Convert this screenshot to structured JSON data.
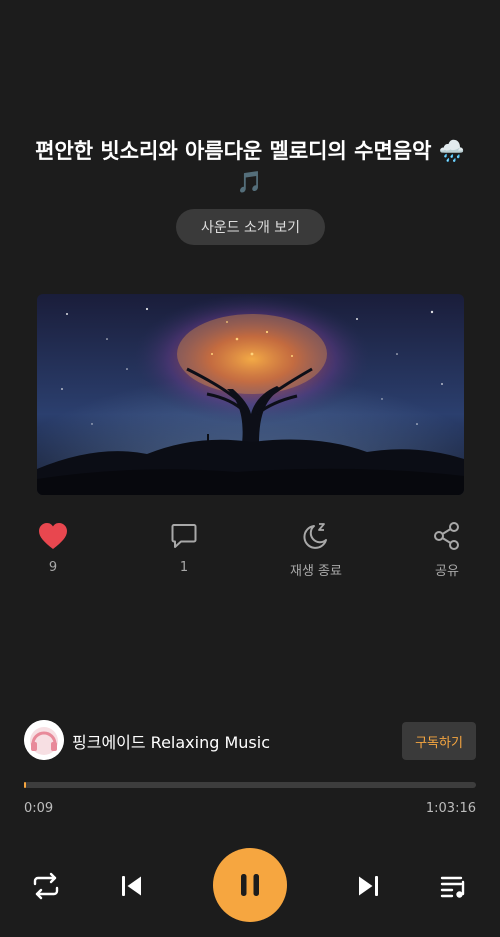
{
  "title": {
    "text": "편안한 빗소리와 아름다운 멜로디의 수면음악",
    "emoji": "🌧️🎵"
  },
  "intro_button": "사운드 소개 보기",
  "actions": {
    "like": {
      "count": "9",
      "icon": "heart-icon",
      "color": "#e8474f"
    },
    "comment": {
      "count": "1",
      "icon": "comment-icon"
    },
    "sleep_timer": {
      "label": "재생 종료",
      "icon": "moon-sleep-icon"
    },
    "share": {
      "label": "공유",
      "icon": "share-icon"
    }
  },
  "channel": {
    "name": "핑크에이드 Relaxing Music",
    "subscribe_label": "구독하기"
  },
  "player": {
    "current_time": "0:09",
    "total_time": "1:03:16",
    "progress": 0.0024,
    "accent": "#f6a640"
  },
  "controls": {
    "repeat": "repeat-icon",
    "previous": "skip-previous-icon",
    "play_pause": "pause-icon",
    "next": "skip-next-icon",
    "playlist": "playlist-icon"
  }
}
